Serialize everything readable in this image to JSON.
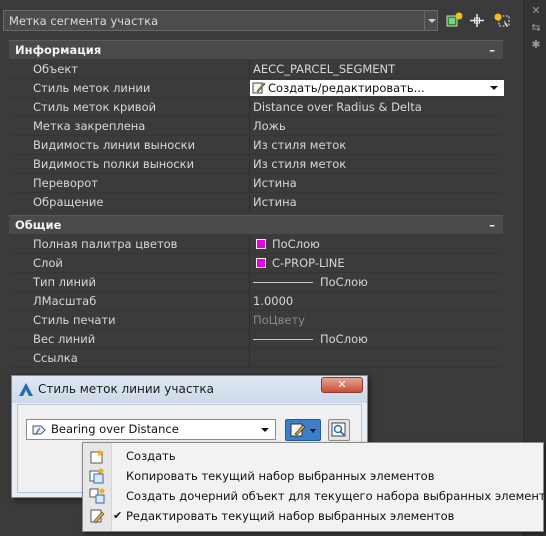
{
  "header": {
    "selector_value": "Метка сегмента участка"
  },
  "sections": [
    {
      "title": "Информация",
      "collapse": "–",
      "rows": [
        {
          "name": "Объект",
          "value": "AECC_PARCEL_SEGMENT"
        },
        {
          "name": "Стиль меток линии",
          "value": "Создать/редактировать..."
        },
        {
          "name": "Стиль меток кривой",
          "value": "Distance over Radius & Delta"
        },
        {
          "name": "Метка закреплена",
          "value": "Ложь"
        },
        {
          "name": "Видимость линии выноски",
          "value": "Из стиля меток"
        },
        {
          "name": "Видимость полки выноски",
          "value": "Из стиля меток"
        },
        {
          "name": "Переворот",
          "value": "Истина"
        },
        {
          "name": "Обращение",
          "value": "Истина"
        }
      ]
    },
    {
      "title": "Общие",
      "collapse": "–",
      "rows": [
        {
          "name": "Полная палитра цветов",
          "value": "ПоСлою"
        },
        {
          "name": "Слой",
          "value": "C-PROP-LINE"
        },
        {
          "name": "Тип линий",
          "value": "ПоСлою"
        },
        {
          "name": "ЛМасштаб",
          "value": "1.0000"
        },
        {
          "name": "Стиль печати",
          "value": "ПоЦвету"
        },
        {
          "name": "Вес линий",
          "value": "ПоСлою"
        },
        {
          "name": "Ссылка",
          "value": ""
        }
      ]
    }
  ],
  "colors": {
    "swatch": "#e600e6",
    "panel_bg": "#3b3b3b",
    "dialog_bg": "#f0f0f0"
  },
  "dialog": {
    "title": "Стиль меток линии участка",
    "close_glyph": "✕",
    "style_value": "Bearing over Distance"
  },
  "menu": {
    "items": [
      {
        "label": "Создать",
        "icon": "create-style-icon",
        "checked": false
      },
      {
        "label": "Копировать текущий набор выбранных элементов",
        "icon": "copy-style-icon",
        "checked": false
      },
      {
        "label": "Создать дочерний объект для текущего набора выбранных элементов",
        "icon": "child-style-icon",
        "checked": false
      },
      {
        "label": "Редактировать текущий набор выбранных элементов",
        "icon": "edit-style-icon",
        "checked": true
      }
    ],
    "check_glyph": "✔"
  }
}
